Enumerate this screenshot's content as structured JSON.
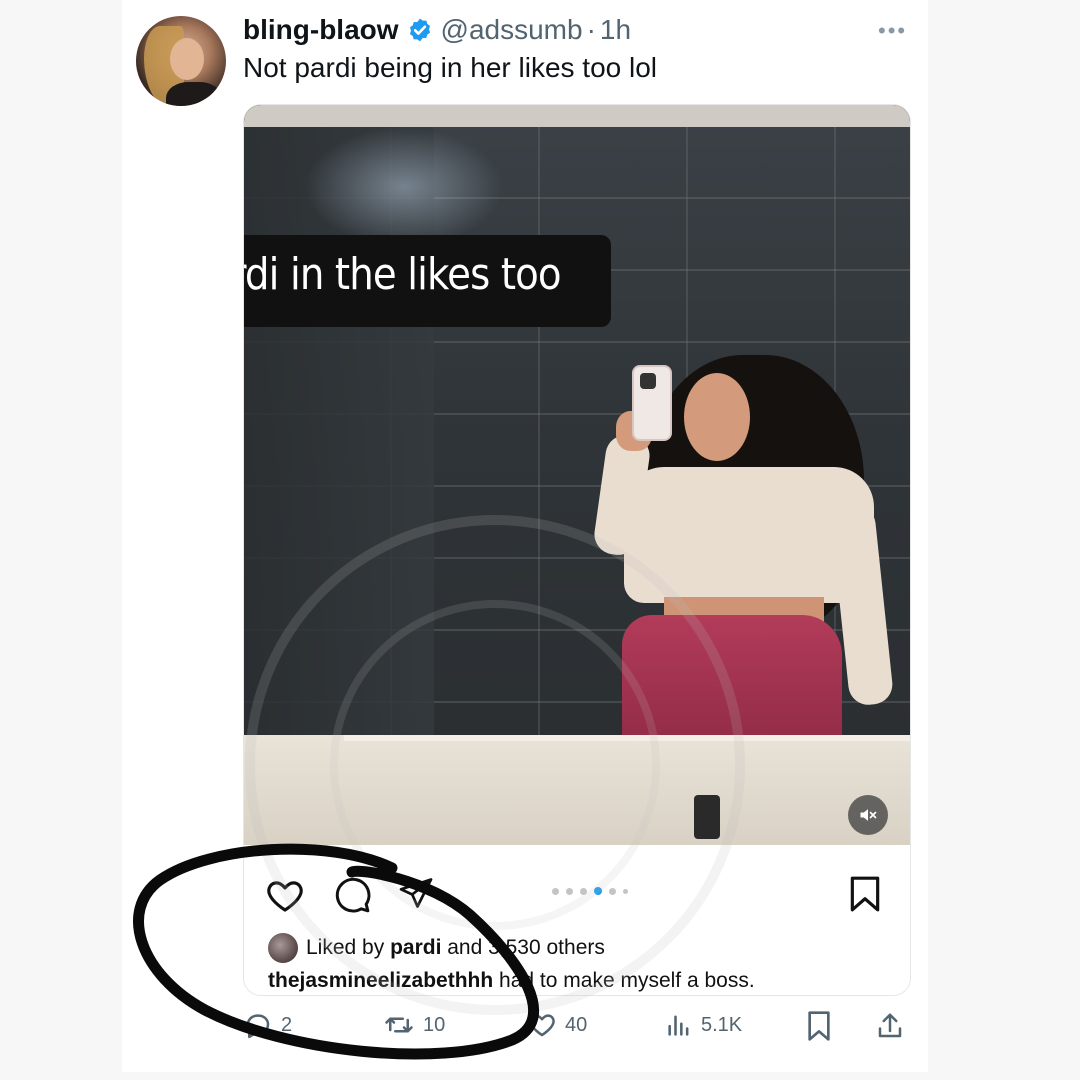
{
  "tweet": {
    "display_name": "bling-blaow",
    "username": "@adssumb",
    "separator": "·",
    "time": "1h",
    "text": "Not pardi being in her likes too lol",
    "more_icon": "more-horizontal-icon"
  },
  "media": {
    "overlay_caption": "Pardi in the likes too",
    "instagram": {
      "liked_prefix": "Liked by ",
      "liked_user": "pardi",
      "liked_suffix": " and 3,530 others",
      "caption_user": "thejasmineelizabethhh",
      "caption_text": " had to make myself a boss."
    }
  },
  "actions": {
    "replies": "2",
    "retweets": "10",
    "likes": "40",
    "views": "5.1K"
  },
  "colors": {
    "accent": "#1d9bf0",
    "text_primary": "#0f1419",
    "text_secondary": "#536471"
  }
}
